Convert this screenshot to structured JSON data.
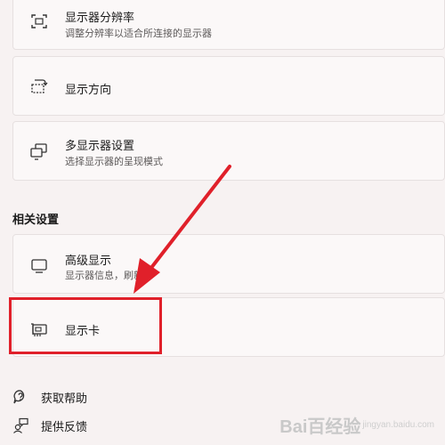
{
  "display_settings": {
    "resolution": {
      "title": "显示器分辨率",
      "subtitle": "调整分辨率以适合所连接的显示器",
      "icon": "resolution-icon"
    },
    "orientation": {
      "title": "显示方向",
      "icon": "rotate-screen-icon"
    },
    "multiple_displays": {
      "title": "多显示器设置",
      "subtitle": "选择显示器的呈现模式",
      "icon": "multiple-displays-icon"
    }
  },
  "related_settings": {
    "heading": "相关设置",
    "advanced_display": {
      "title": "高级显示",
      "subtitle": "显示器信息，刷新率",
      "icon": "monitor-icon"
    },
    "graphics": {
      "title": "显示卡",
      "icon": "graphics-card-icon"
    }
  },
  "footer": {
    "help": {
      "label": "获取帮助",
      "icon": "help-icon"
    },
    "feedback": {
      "label": "提供反馈",
      "icon": "feedback-icon"
    }
  },
  "annotation": {
    "color": "#e0202a"
  },
  "watermark": {
    "text": "Bai百经验",
    "sub": "jingyan.baidu.com"
  }
}
